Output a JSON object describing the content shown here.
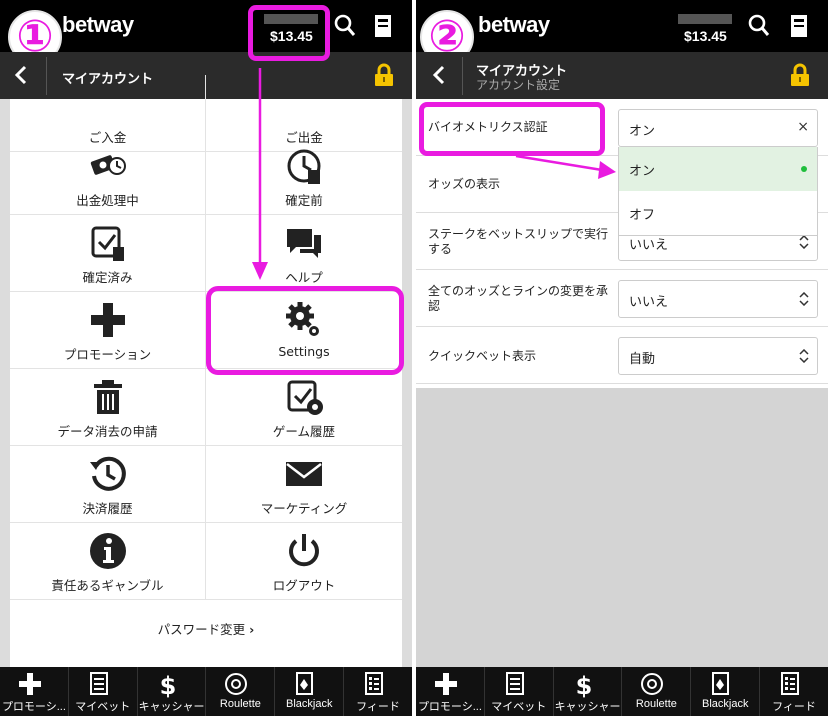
{
  "left_panel": {
    "step_number": "①",
    "brand": "betway",
    "balance": "$13.45",
    "header_title": "マイアカウント",
    "menu_items": [
      {
        "label": "ご入金",
        "icon": "deposit-icon"
      },
      {
        "label": "ご出金",
        "icon": "withdraw-icon"
      },
      {
        "label": "出金処理中",
        "icon": "pending-withdrawal-icon"
      },
      {
        "label": "確定前",
        "icon": "clock-icon"
      },
      {
        "label": "確定済み",
        "icon": "settled-bets-icon"
      },
      {
        "label": "ヘルプ",
        "icon": "chat-icon"
      },
      {
        "label": "プロモーション",
        "icon": "plus-icon"
      },
      {
        "label": "Settings",
        "icon": "gear-icon"
      },
      {
        "label": "データ消去の申請",
        "icon": "trash-icon"
      },
      {
        "label": "ゲーム履歴",
        "icon": "game-history-icon"
      },
      {
        "label": "決済履歴",
        "icon": "history-icon"
      },
      {
        "label": "マーケティング",
        "icon": "envelope-icon"
      },
      {
        "label": "責任あるギャンブル",
        "icon": "info-icon"
      },
      {
        "label": "ログアウト",
        "icon": "power-icon"
      }
    ],
    "password_change": "パスワード変更"
  },
  "right_panel": {
    "step_number": "②",
    "brand": "betway",
    "balance": "$13.45",
    "header_title": "マイアカウント",
    "header_subtitle": "アカウント設定",
    "settings": [
      {
        "label": "バイオメトリクス認証",
        "value": "オン",
        "control": "×"
      },
      {
        "label": "オッズの表示",
        "value": "",
        "control": ""
      },
      {
        "label": "ステークをベットスリップで実行する",
        "value": "いいえ",
        "control": "⌃⌄"
      },
      {
        "label": "全てのオッズとラインの変更を承認",
        "value": "いいえ",
        "control": "⌃⌄"
      },
      {
        "label": "クイックベット表示",
        "value": "自動",
        "control": "⌃⌄"
      }
    ],
    "dropdown_options": [
      {
        "label": "オン",
        "selected": true
      },
      {
        "label": "オフ",
        "selected": false
      }
    ]
  },
  "bottom_nav": [
    {
      "label": "プロモーシ...",
      "icon": "plus-icon"
    },
    {
      "label": "マイベット",
      "icon": "betslip-icon"
    },
    {
      "label": "キャッシャー",
      "icon": "dollar-icon"
    },
    {
      "label": "Roulette",
      "icon": "roulette-icon"
    },
    {
      "label": "Blackjack",
      "icon": "cards-icon"
    },
    {
      "label": "フィード",
      "icon": "feed-icon"
    }
  ],
  "colors": {
    "highlight": "#e91be0",
    "topbar": "#000000",
    "subbar": "#2b2b2b",
    "accent_yellow": "#f5c400",
    "selected_green": "#1fbe3c"
  }
}
